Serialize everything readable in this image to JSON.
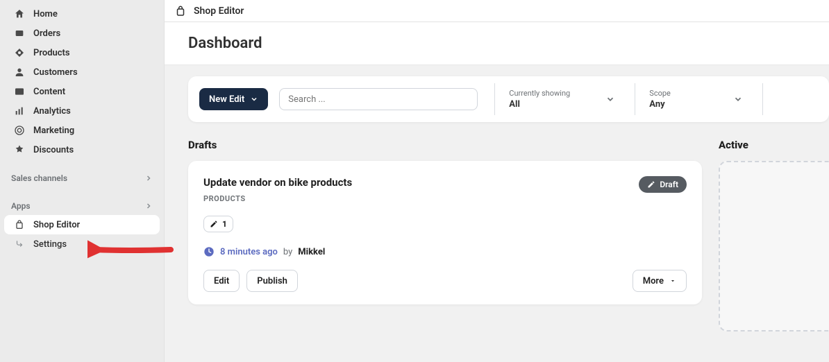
{
  "sidebar": {
    "items": [
      {
        "label": "Home"
      },
      {
        "label": "Orders"
      },
      {
        "label": "Products"
      },
      {
        "label": "Customers"
      },
      {
        "label": "Content"
      },
      {
        "label": "Analytics"
      },
      {
        "label": "Marketing"
      },
      {
        "label": "Discounts"
      }
    ],
    "sales_channels_label": "Sales channels",
    "apps_label": "Apps",
    "apps_items": [
      {
        "label": "Shop Editor"
      },
      {
        "label": "Settings"
      }
    ]
  },
  "topbar": {
    "title": "Shop Editor"
  },
  "page": {
    "title": "Dashboard"
  },
  "filterbar": {
    "new_edit_label": "New Edit",
    "search_placeholder": "Search ...",
    "currently_showing_label": "Currently showing",
    "currently_showing_value": "All",
    "scope_label": "Scope",
    "scope_value": "Any"
  },
  "drafts": {
    "heading": "Drafts",
    "card": {
      "title": "Update vendor on bike products",
      "subtitle": "PRODUCTS",
      "badge": "Draft",
      "chip_count": "1",
      "time": "8 minutes ago",
      "by_label": "by",
      "author": "Mikkel",
      "edit_label": "Edit",
      "publish_label": "Publish",
      "more_label": "More"
    }
  },
  "active": {
    "heading": "Active"
  }
}
